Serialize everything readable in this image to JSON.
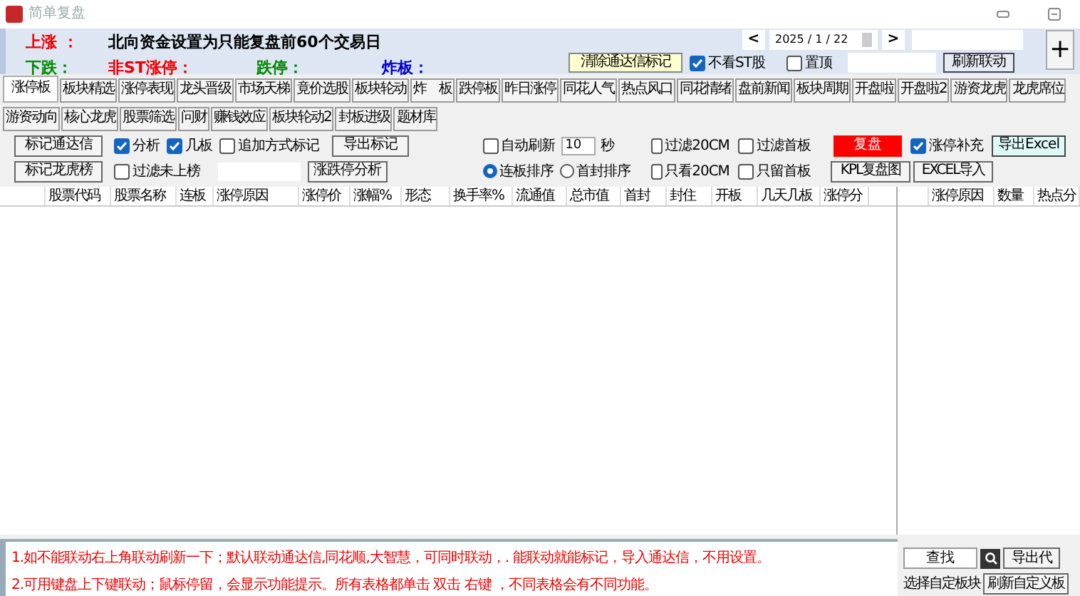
{
  "window": {
    "title": "简单复盘"
  },
  "info": {
    "up_label": "上涨 ：",
    "notice": "北向资金设置为只能复盘前60个交易日",
    "down_label": "下跌：",
    "limit_up_label": "非ST涨停：",
    "limit_down_label": "跌停：",
    "broken_label": "炸板："
  },
  "date_picker": {
    "value": "2025 / 1 / 22",
    "prev": "<",
    "next": ">"
  },
  "clear_button": "清除通达信标记",
  "hide_st": {
    "label": "不看ST股",
    "checked": true
  },
  "top": {
    "label": "置顶",
    "checked": false
  },
  "refresh_link_button": "刷新联动",
  "plus": "+",
  "tabs_row_1": [
    {
      "label": "涨停板",
      "selected": true
    },
    {
      "label": "板块精选",
      "selected": false
    },
    {
      "label": "涨停表现",
      "selected": false
    },
    {
      "label": "龙头晋级",
      "selected": false
    },
    {
      "label": "市场天梯",
      "selected": false
    },
    {
      "label": "竟价选股",
      "selected": false
    },
    {
      "label": "板块轮动",
      "selected": false
    },
    {
      "label": "炸　板",
      "selected": false
    },
    {
      "label": "跌停板",
      "selected": false
    },
    {
      "label": "昨日涨停",
      "selected": false
    },
    {
      "label": "同花人气",
      "selected": false
    },
    {
      "label": "热点风口",
      "selected": false
    },
    {
      "label": "同花情绪",
      "selected": false
    },
    {
      "label": "盘前新闻",
      "selected": false
    },
    {
      "label": "板块周期",
      "selected": false
    },
    {
      "label": "开盘啦",
      "selected": false
    },
    {
      "label": "开盘啦2",
      "selected": false
    },
    {
      "label": "游资龙虎",
      "selected": false
    },
    {
      "label": "龙虎席位",
      "selected": false
    }
  ],
  "tabs_row_2": [
    {
      "label": "游资动向",
      "selected": false
    },
    {
      "label": "核心龙虎",
      "selected": false
    },
    {
      "label": "股票筛选",
      "selected": false
    },
    {
      "label": "问财",
      "selected": false
    },
    {
      "label": "赚钱效应",
      "selected": false
    },
    {
      "label": "板块轮动2",
      "selected": false
    },
    {
      "label": "封板进级",
      "selected": false
    },
    {
      "label": "题材库",
      "selected": false
    }
  ],
  "mark_tdx_button": "标记通达信",
  "mark_lhb_button": "标记龙虎榜",
  "checkboxes": [
    {
      "label": "分析",
      "checked": true
    },
    {
      "label": "几板",
      "checked": true
    },
    {
      "label": "追加方式标记",
      "checked": false
    },
    {
      "label": "自动刷新",
      "checked": false
    },
    {
      "label": "过滤20CM",
      "checked": false
    },
    {
      "label": "过滤首板",
      "checked": false
    },
    {
      "label": "涨停补充",
      "checked": true
    },
    {
      "label": "过滤未上榜",
      "checked": false
    },
    {
      "label": "只看20CM",
      "checked": false
    },
    {
      "label": "只留首板",
      "checked": false
    }
  ],
  "export_mark_button": "导出标记",
  "analysis_button": "涨跌停分析",
  "interval": {
    "value": "10",
    "unit": "秒"
  },
  "sort": [
    {
      "label": "连板排序",
      "selected": true
    },
    {
      "label": "首封排序",
      "selected": false
    }
  ],
  "replay_button": "复盘",
  "export_excel_button": "导出Excel",
  "kpl_button": "KPL复盘图",
  "excel_import_button": "EXCEL导入",
  "table": {
    "columns": [
      "股票代码",
      "股票名称",
      "连板",
      "涨停原因",
      "涨停价",
      "涨幅%",
      "形态",
      "换手率%",
      "流通值",
      "总市值",
      "首封",
      "封住",
      "开板",
      "几天几板",
      "涨停分"
    ]
  },
  "side_table": {
    "columns": [
      "涨停原因",
      "数量",
      "热点分"
    ]
  },
  "notes": [
    "1.如不能联动右上角联动刷新一下；默认联动通达信,同花顺,大智慧，可同时联动，. 能联动就能标记，导入通达信，不用设置。",
    "2.可用键盘上下键联动；鼠标停留，会显示功能提示。所有表格都单击 双击 右键 ，不同表格会有不同功能。"
  ],
  "search_button": "查找",
  "export_code_button": "导出代",
  "custom_block_label": "选择自定板块",
  "refresh_custom_button": "刷新自定义板"
}
